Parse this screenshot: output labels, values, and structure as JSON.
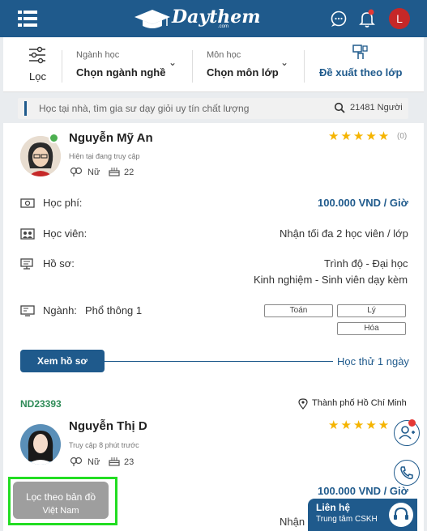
{
  "header": {
    "logo_text": "Daythem",
    "logo_sub": ".com",
    "avatar_initial": "L"
  },
  "filters": {
    "location_label": "Lọc",
    "major": {
      "title": "Ngành học",
      "value": "Chọn ngành nghề"
    },
    "subject": {
      "title": "Môn học",
      "value": "Chọn môn lớp"
    },
    "suggest_label": "Đề xuất theo lớp"
  },
  "search": {
    "placeholder": "Học tại nhà, tìm gia sư dạy giỏi uy tín chất lượng",
    "count": "21481 Người"
  },
  "tutors": [
    {
      "name": "Nguyễn Mỹ An",
      "status": "Hiện tại đang truy cập",
      "gender": "Nữ",
      "age": "22",
      "rating_count": "(0)",
      "stars": "★★★★★",
      "fee_label": "Học phí:",
      "fee": "100.000 VND / Giờ",
      "students_label": "Học viên:",
      "students": "Nhận tối đa 2 học viên / lớp",
      "profile_label": "Hồ sơ:",
      "level": "Trình độ - Đại học",
      "experience": "Kinh nghiệm - Sinh viên dạy kèm",
      "major_label": "Ngành:",
      "major": "Phổ thông 1",
      "subjects": [
        "Toán",
        "Lý",
        "Hóa"
      ],
      "view_button": "Xem hồ sơ",
      "trial": "Học thử 1 ngày",
      "code": "ND23393",
      "location": "Thành phố Hồ Chí Minh"
    },
    {
      "name": "Nguyễn Thị D",
      "status": "Truy cập 8 phút trước",
      "gender": "Nữ",
      "age": "23",
      "stars": "★★★★★",
      "fee": "100.000 VND / Giờ",
      "students_partial": "Nhận"
    }
  ],
  "floating": {
    "map_title": "Lọc theo bản đồ",
    "map_sub": "Việt Nam",
    "contact_title": "Liên hệ",
    "contact_sub": "Trung tâm CSKH"
  },
  "colors": {
    "brand": "#1f5a8c",
    "star": "#f5b400",
    "code_green": "#2e8b57",
    "highlight": "#22dd22"
  }
}
